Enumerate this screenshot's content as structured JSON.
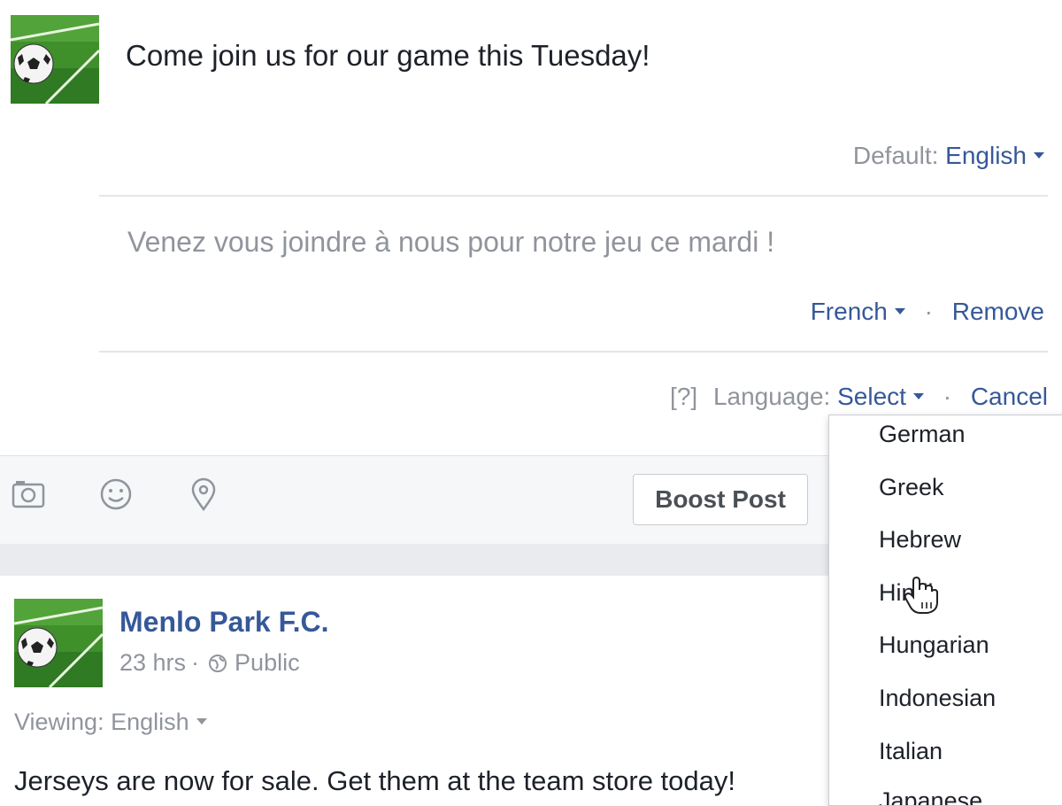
{
  "composer": {
    "text": "Come join us for our game this Tuesday!",
    "default_label": "Default:",
    "default_language": "English",
    "translation_text": "Venez vous joindre à nous pour notre jeu ce mardi !",
    "translation_language": "French",
    "separator": "·",
    "remove_label": "Remove",
    "help_label": "[?]",
    "language_label": "Language:",
    "select_label": "Select",
    "cancel_label": "Cancel"
  },
  "toolbar": {
    "icons": [
      "camera-icon",
      "smiley-icon",
      "location-pin-icon"
    ],
    "boost_label": "Boost Post"
  },
  "language_dropdown": {
    "items": [
      "German",
      "Greek",
      "Hebrew",
      "Hindi",
      "Hungarian",
      "Indonesian",
      "Italian",
      "Japanese"
    ]
  },
  "post": {
    "page_name": "Menlo Park F.C.",
    "time": "23 hrs",
    "dot": "·",
    "audience": "Public",
    "viewing_label": "Viewing:",
    "viewing_language": "English",
    "body": "Jerseys are now for sale. Get them at the team store today!"
  },
  "colors": {
    "link": "#365899",
    "muted": "#90949c",
    "toolbar_bg": "#f6f7f9",
    "grass": "#3f8f2b"
  }
}
